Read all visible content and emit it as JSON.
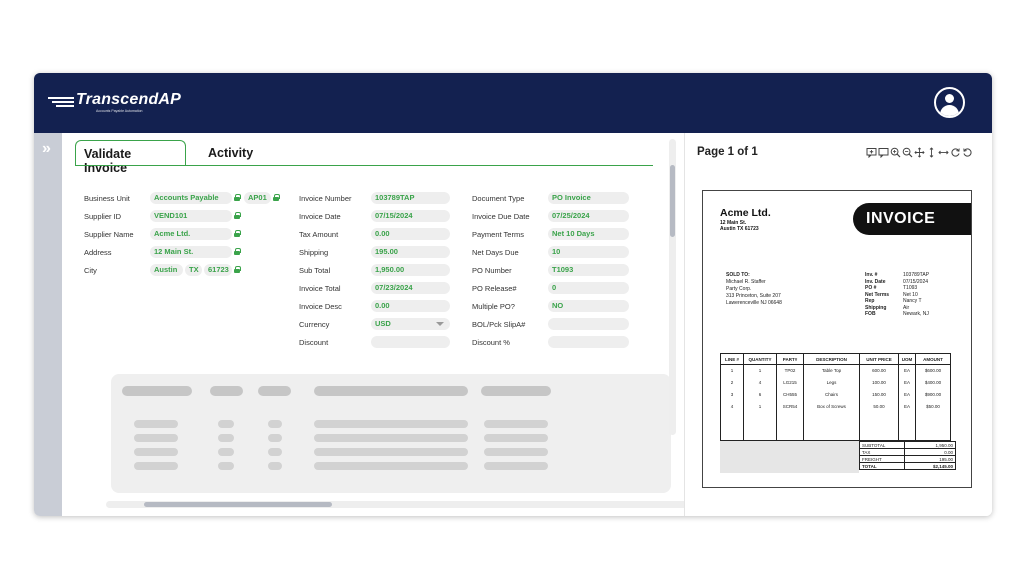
{
  "app": {
    "brand": "TranscendAP",
    "tagline": "Accounts Payable Automation"
  },
  "tabs": [
    {
      "label": "Validate Invoice"
    },
    {
      "label": "Activity"
    }
  ],
  "form": {
    "col1": [
      {
        "label": "Business Unit",
        "values": [
          "Accounts Payable",
          "AP01"
        ]
      },
      {
        "label": "Supplier ID",
        "values": [
          "VEND101"
        ]
      },
      {
        "label": "Supplier Name",
        "values": [
          "Acme Ltd."
        ]
      },
      {
        "label": "Address",
        "values": [
          "12 Main St."
        ]
      },
      {
        "label": "City",
        "values": [
          "Austin",
          "TX",
          "61723"
        ]
      }
    ],
    "col2": [
      {
        "label": "Invoice Number",
        "value": "103789TAP"
      },
      {
        "label": "Invoice Date",
        "value": "07/15/2024"
      },
      {
        "label": "Tax Amount",
        "value": "0.00"
      },
      {
        "label": "Shipping",
        "value": "195.00"
      },
      {
        "label": "Sub Total",
        "value": "1,950.00"
      },
      {
        "label": "Invoice Total",
        "value": "07/23/2024"
      },
      {
        "label": "Invoice Desc",
        "value": "0.00"
      },
      {
        "label": "Currency",
        "value": "USD"
      },
      {
        "label": "Discount",
        "value": ""
      }
    ],
    "col3": [
      {
        "label": "Document Type",
        "value": "PO Invoice"
      },
      {
        "label": "Invoice Due Date",
        "value": "07/25/2024"
      },
      {
        "label": "Payment Terms",
        "value": "Net 10 Days"
      },
      {
        "label": "Net Days Due",
        "value": "10"
      },
      {
        "label": "PO Number",
        "value": "T1093"
      },
      {
        "label": "PO Release#",
        "value": "0"
      },
      {
        "label": "Multiple PO?",
        "value": "NO"
      },
      {
        "label": "BOL/Pck SlipA#",
        "value": ""
      },
      {
        "label": "Discount %",
        "value": ""
      }
    ]
  },
  "viewer": {
    "page_label": "Page 1 of 1",
    "tools": [
      "comment-add-icon",
      "comment-icon",
      "zoom-in-icon",
      "zoom-out-icon",
      "move-icon",
      "fit-height-icon",
      "fit-width-icon",
      "rotate-right-icon",
      "rotate-left-icon"
    ]
  },
  "invoice": {
    "company": "Acme Ltd.",
    "address1": "12 Main St.",
    "address2": "Austin TX 61723",
    "title": "INVOICE",
    "sold_to_label": "SOLD TO:",
    "sold_to": [
      "Michael R. Staffer",
      "Party Corp.",
      "313 Princeton, Suite 207",
      "Lawerenceville NJ 06648"
    ],
    "meta": [
      {
        "k": "Inv. #",
        "v": "103789TAP"
      },
      {
        "k": "Inv. Date",
        "v": "07/15/2024"
      },
      {
        "k": "PO #",
        "v": "T1093"
      },
      {
        "k": "Net Terms",
        "v": "Net 10"
      },
      {
        "k": "Rep",
        "v": "Nancy T"
      },
      {
        "k": "Shipping",
        "v": "Air"
      },
      {
        "k": "FOB",
        "v": "Newark, NJ"
      }
    ],
    "columns": [
      "LINE #",
      "QUANTITY",
      "PART#",
      "DESCRIPTION",
      "UNIT PRICE",
      "UOM",
      "AMOUNT"
    ],
    "lines": [
      [
        "1",
        "1",
        "TP02",
        "Table Top",
        "600.00",
        "EA",
        "$600.00"
      ],
      [
        "2",
        "4",
        "LG215",
        "Legs",
        "100.00",
        "EA",
        "$400.00"
      ],
      [
        "3",
        "6",
        "CH555",
        "Chairs",
        "150.00",
        "EA",
        "$900.00"
      ],
      [
        "4",
        "1",
        "SCR54",
        "Box of Screws",
        "50.00",
        "EA",
        "$50.00"
      ]
    ],
    "totals": [
      {
        "k": "SUBTOTAL",
        "v": "1,950.00"
      },
      {
        "k": "TAX",
        "v": "0.00"
      },
      {
        "k": "FREIGHT",
        "v": "195.00"
      },
      {
        "k": "TOTAL",
        "v": "$2,145.00"
      }
    ]
  },
  "colors": {
    "navy": "#132150",
    "accent_green": "#3aa34a",
    "pill_bg": "#eeeeee"
  }
}
